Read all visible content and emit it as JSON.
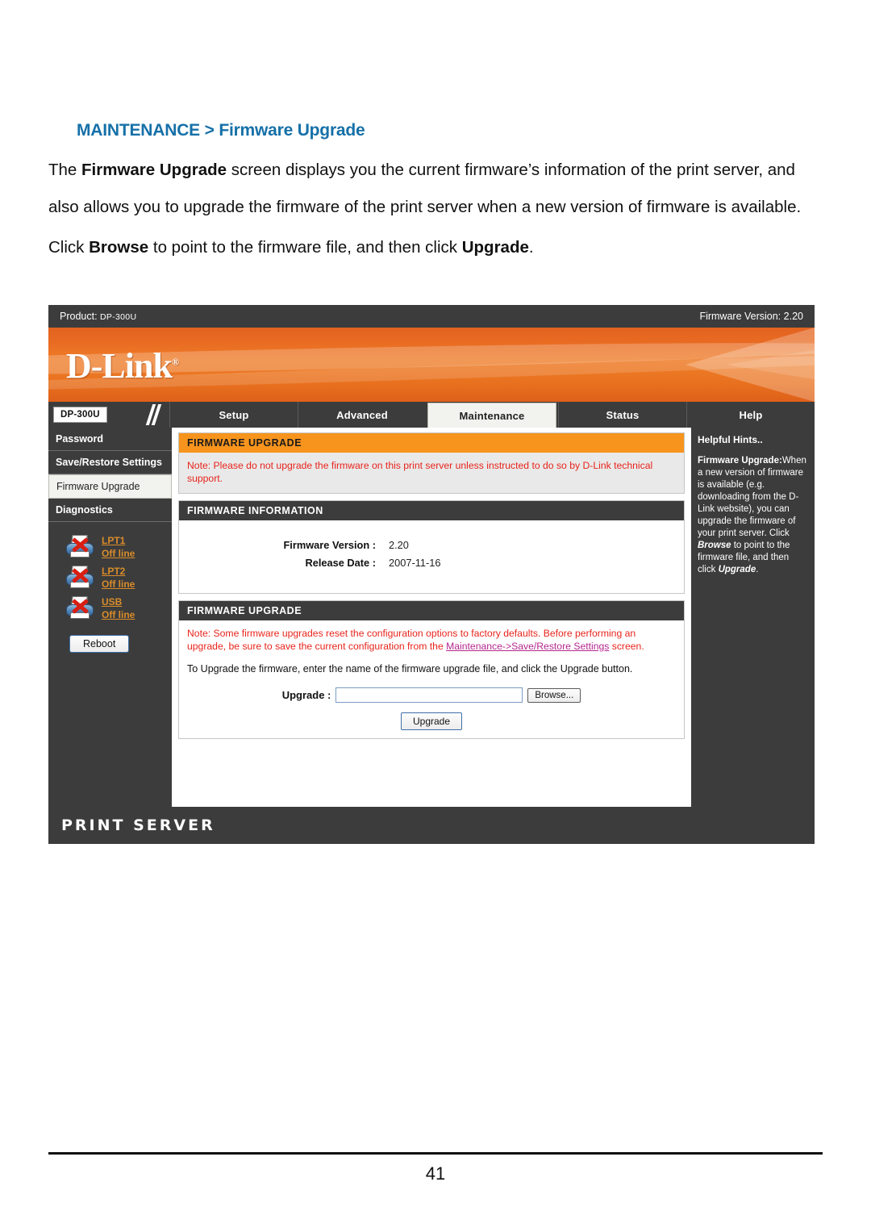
{
  "document": {
    "heading_main": "MAINTENANCE",
    "heading_sep": " > ",
    "heading_sub": "Firmware Upgrade",
    "paragraph1_a": "The ",
    "paragraph1_b": "Firmware Upgrade",
    "paragraph1_c": " screen displays you the current firmware’s information of the print server, and also allows you to upgrade the firmware of the print server when a new version of firmware is available.",
    "paragraph2_a": "Click ",
    "paragraph2_b": "Browse",
    "paragraph2_c": " to point to the firmware file, and then click ",
    "paragraph2_d": "Upgrade",
    "paragraph2_e": ".",
    "page_number": "41"
  },
  "screenshot": {
    "product_bar": {
      "product_label": "Product:",
      "product_value": "DP-300U",
      "firmware_label": "Firmware Version:",
      "firmware_value": "2.20"
    },
    "banner": {
      "logo_text": "D-Link",
      "logo_trademark": "®"
    },
    "nav": {
      "model_chip": "DP-300U",
      "tabs": [
        {
          "label": "Setup",
          "active": false
        },
        {
          "label": "Advanced",
          "active": false
        },
        {
          "label": "Maintenance",
          "active": true
        },
        {
          "label": "Status",
          "active": false
        },
        {
          "label": "Help",
          "active": false
        }
      ]
    },
    "sidebar": {
      "items": [
        {
          "label": "Password",
          "active": false
        },
        {
          "label": "Save/Restore Settings",
          "active": false
        },
        {
          "label": "Firmware Upgrade",
          "active": true
        },
        {
          "label": "Diagnostics",
          "active": false
        }
      ],
      "printers": [
        {
          "name": "LPT1",
          "status": "Off line"
        },
        {
          "name": "LPT2",
          "status": "Off line"
        },
        {
          "name": "USB",
          "status": "Off line"
        }
      ],
      "reboot_label": "Reboot"
    },
    "main": {
      "panel_top_title": "FIRMWARE UPGRADE",
      "panel_top_note": "Note: Please do not upgrade the firmware on this print server unless instructed to do so by D-Link technical support.",
      "panel_info_title": "FIRMWARE INFORMATION",
      "info_rows": [
        {
          "key": "Firmware Version :",
          "value": "2.20"
        },
        {
          "key": "Release Date :",
          "value": "2007-11-16"
        }
      ],
      "panel_upgrade_title": "FIRMWARE UPGRADE",
      "upgrade_note_a": "Note: Some firmware upgrades reset the configuration options to factory defaults. Before performing an upgrade, be sure to save the current configuration from the ",
      "upgrade_note_link": "Maintenance->Save/Restore Settings",
      "upgrade_note_b": " screen.",
      "upgrade_instruction": "To Upgrade the firmware, enter the name of the firmware upgrade file, and click the Upgrade button.",
      "upgrade_label": "Upgrade :",
      "upgrade_value": "",
      "upgrade_placeholder": "",
      "browse_label": "Browse...",
      "upgrade_button_label": "Upgrade"
    },
    "hints": {
      "title": "Helpful Hints..",
      "subtitle": "Firmware Upgrade:",
      "text_a": "When a new version of firmware is available (e.g. downloading from the D-Link website), you can upgrade the firmware of your print server. Click ",
      "text_browse": "Browse",
      "text_b": " to point to the firmware file, and then click ",
      "text_upgrade": "Upgrade",
      "text_c": "."
    },
    "footer": {
      "label": "PRINT SERVER"
    },
    "colors": {
      "heading_blue": "#1670A8",
      "panel_orange": "#F7941E",
      "panel_dark": "#3c3c3c",
      "note_red": "#e8241c",
      "link_orange": "#d98c2b",
      "link_purple": "#b4278f"
    }
  }
}
